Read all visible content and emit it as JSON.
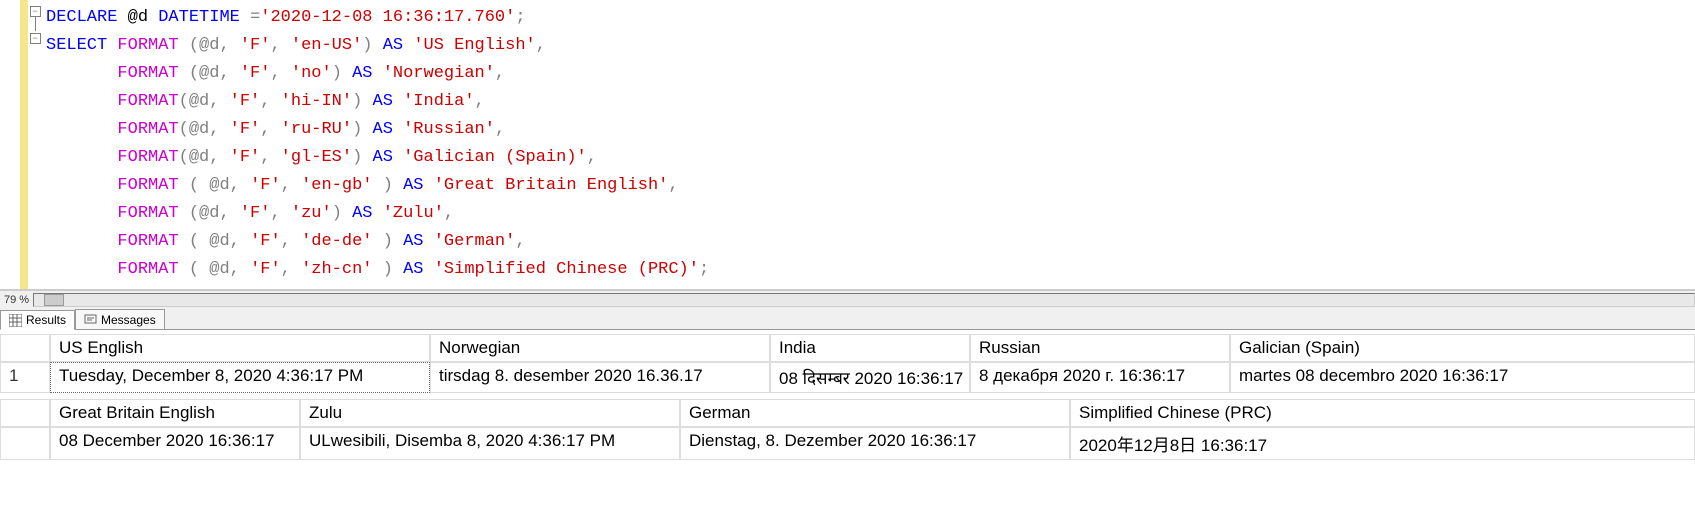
{
  "zoom": "79 %",
  "tabs": {
    "results": "Results",
    "messages": "Messages"
  },
  "code": {
    "line1_declare": "DECLARE",
    "line1_var": " @d ",
    "line1_dt": "DATETIME ",
    "line1_eq": "=",
    "line1_str": "'2020-12-08 16:36:17.760'",
    "line1_semi": ";",
    "select": "SELECT",
    "format": "FORMAT",
    "as": "AS",
    "l2a": " (@d, ",
    "l2f": "'F'",
    "l2c": ", ",
    "l2loc": "'en-US'",
    "l2p": ") ",
    "l2al": "'US English'",
    "l2end": ",",
    "l3a": " (@d, ",
    "l3loc": "'no'",
    "l3al": "'Norwegian'",
    "l4a": "(@d, ",
    "l4loc": "'hi-IN'",
    "l4al": "'India'",
    "l5loc": "'ru-RU'",
    "l5al": "'Russian'",
    "l6loc": "'gl-ES'",
    "l6al": "'Galician (Spain)'",
    "l7a": " ( @d, ",
    "l7loc": "'en-gb'",
    "l7p": " ) ",
    "l7al": "'Great Britain English'",
    "l8loc": "'zu'",
    "l8al": "'Zulu'",
    "l9loc": "'de-de'",
    "l9al": "'German'",
    "l10loc": "'zh-cn'",
    "l10al": "'Simplified Chinese (PRC)'",
    "l10end": ";"
  },
  "results1": {
    "rownum": "1",
    "headers": [
      "US English",
      "Norwegian",
      "India",
      "Russian",
      "Galician (Spain)"
    ],
    "row": [
      "Tuesday, December 8, 2020 4:36:17 PM",
      "tirsdag 8. desember 2020 16.36.17",
      "08 दिसम्बर 2020 16:36:17",
      "8 декабря 2020 г. 16:36:17",
      "martes 08 decembro 2020 16:36:17"
    ]
  },
  "results2": {
    "headers": [
      "Great Britain English",
      "Zulu",
      "German",
      "Simplified Chinese (PRC)"
    ],
    "row": [
      "08 December 2020 16:36:17",
      "ULwesibili, Disemba 8, 2020 4:36:17 PM",
      "Dienstag, 8. Dezember 2020 16:36:17",
      "2020年12月8日 16:36:17"
    ]
  }
}
